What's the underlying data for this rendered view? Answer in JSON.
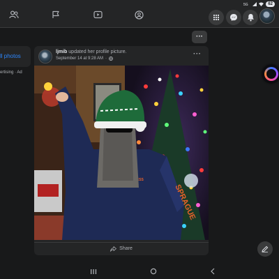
{
  "status_bar": {
    "battery": "62"
  },
  "colors": {
    "accent": "#2d88ff",
    "background": "#18191a",
    "card": "#242526",
    "text": "#e4e6eb",
    "muted": "#b0b3b8"
  },
  "nav": {
    "tabs": [
      {
        "icon": "friends-icon"
      },
      {
        "icon": "pages-flag-icon"
      },
      {
        "icon": "watch-video-icon"
      },
      {
        "icon": "groups-icon"
      }
    ],
    "actions": [
      {
        "icon": "menu-grid-icon"
      },
      {
        "icon": "messenger-icon"
      },
      {
        "icon": "notifications-bell-icon"
      }
    ]
  },
  "sidebar": {
    "all_photos_label": "ll photos",
    "footer_text": "ertising · Ad"
  },
  "more_label": "···",
  "post": {
    "author": "ljmib",
    "action": " updated her profile picture.",
    "timestamp": "September 14 at 9:28 AM",
    "privacy_dot": "·",
    "privacy_icon": "globe-icon",
    "more_label": "···",
    "share_label": "Share"
  }
}
